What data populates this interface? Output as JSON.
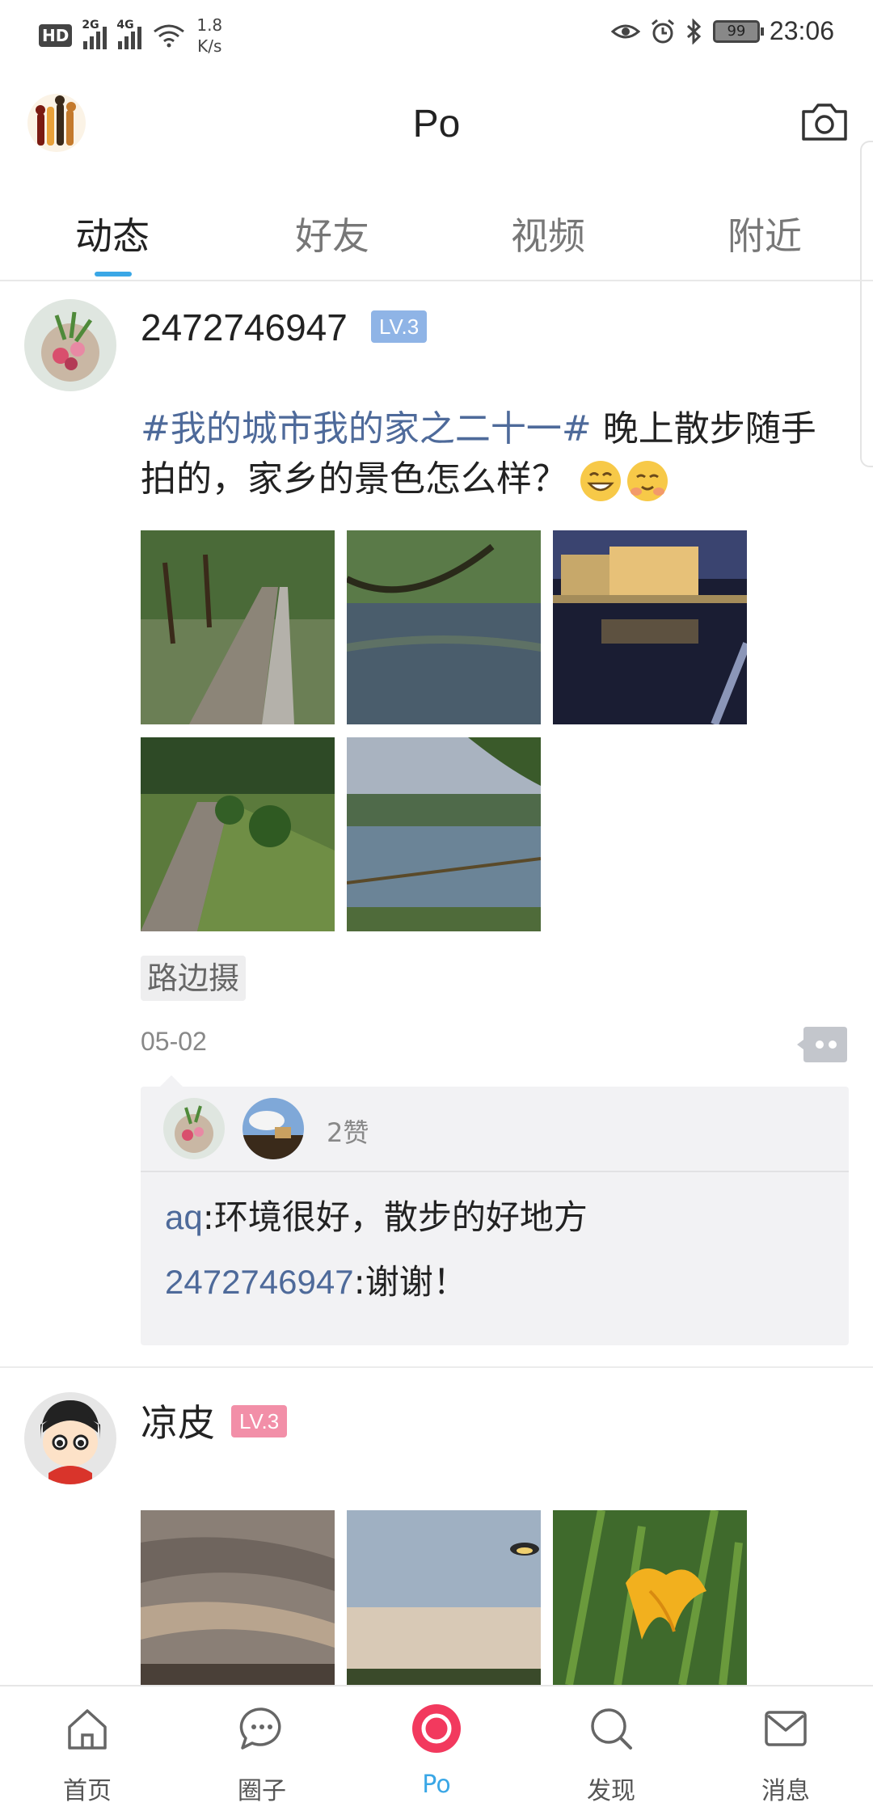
{
  "status_bar": {
    "hd": "HD",
    "sim1": "2G",
    "sim2": "4G",
    "speed_value": "1.8",
    "speed_unit": "K/s",
    "battery": "99",
    "time": "23:06"
  },
  "header": {
    "title": "Po"
  },
  "tabs": [
    {
      "label": "动态",
      "active": true
    },
    {
      "label": "好友",
      "active": false
    },
    {
      "label": "视频",
      "active": false
    },
    {
      "label": "附近",
      "active": false
    }
  ],
  "posts": [
    {
      "username": "2472746947",
      "level": "LV.3",
      "level_color": "#8fb4e6",
      "hashtag": "#我的城市我的家之二十一#",
      "text": " 晚上散步随手拍的，家乡的景色怎么样？",
      "emojis": [
        "grin-emoji",
        "blush-emoji"
      ],
      "tag": "路边摄",
      "date": "05-02",
      "likes": "2赞",
      "comments": [
        {
          "author": "aq",
          "text": ":环境很好，散步的好地方"
        },
        {
          "author": "2472746947",
          "text": ":谢谢！"
        }
      ]
    },
    {
      "username": "凉皮",
      "level": "LV.3",
      "level_color": "#f28fa8"
    }
  ],
  "bottom_nav": [
    {
      "label": "首页",
      "icon": "home-icon",
      "active": false
    },
    {
      "label": "圈子",
      "icon": "chat-bubble-icon",
      "active": false
    },
    {
      "label": "Po",
      "icon": "po-record-icon",
      "active": true
    },
    {
      "label": "发现",
      "icon": "search-icon",
      "active": false
    },
    {
      "label": "消息",
      "icon": "mail-icon",
      "active": false
    }
  ],
  "colors": {
    "accent": "#3aa7e6",
    "po_button": "#f2395e",
    "link": "#4e6a9a"
  }
}
